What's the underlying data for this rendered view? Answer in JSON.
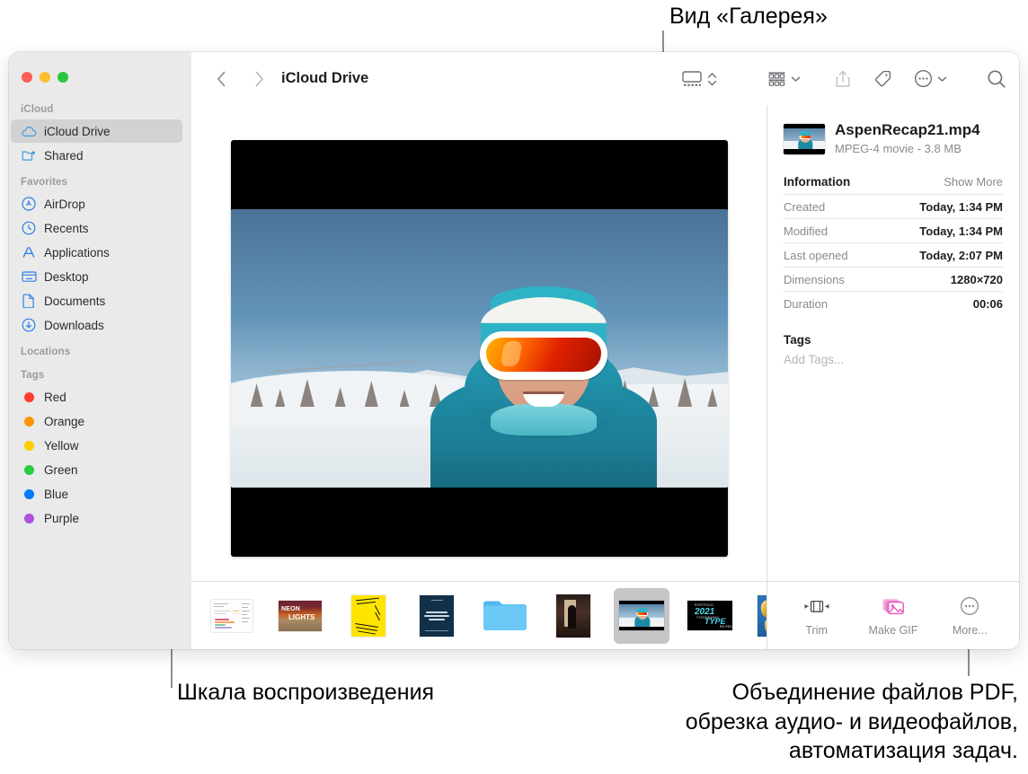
{
  "annotations": {
    "gallery_view": "Вид «Галерея»",
    "playback_scrubber": "Шкала воспроизведения",
    "quick_actions": "Объединение файлов PDF,\nобрезка аудио- и видеофайлов,\nавтоматизация задач."
  },
  "toolbar": {
    "title": "iCloud Drive",
    "back_icon": "chevron-left-icon",
    "forward_icon": "chevron-right-icon",
    "view_icon": "gallery-view-icon",
    "view_chevrons_icon": "chevron-up-down-icon",
    "group_icon": "group-by-icon",
    "group_chevron_icon": "chevron-down-icon",
    "share_icon": "share-icon",
    "tag_icon": "tag-icon",
    "more_icon": "more-actions-icon",
    "more_chevron_icon": "chevron-down-icon",
    "search_icon": "search-icon"
  },
  "window_controls": {
    "close": "close-button",
    "minimize": "minimize-button",
    "zoom": "zoom-button",
    "colors": {
      "close": "#ff5f57",
      "minimize": "#febc2e",
      "zoom": "#28c840"
    }
  },
  "sidebar": {
    "sections": [
      {
        "label": "iCloud",
        "items": [
          {
            "label": "iCloud Drive",
            "icon": "icloud-icon",
            "selected": true
          },
          {
            "label": "Shared",
            "icon": "shared-folder-icon",
            "selected": false
          }
        ]
      },
      {
        "label": "Favorites",
        "items": [
          {
            "label": "AirDrop",
            "icon": "airdrop-icon",
            "selected": false
          },
          {
            "label": "Recents",
            "icon": "clock-icon",
            "selected": false
          },
          {
            "label": "Applications",
            "icon": "applications-icon",
            "selected": false
          },
          {
            "label": "Desktop",
            "icon": "desktop-icon",
            "selected": false
          },
          {
            "label": "Documents",
            "icon": "document-icon",
            "selected": false
          },
          {
            "label": "Downloads",
            "icon": "downloads-icon",
            "selected": false
          }
        ]
      },
      {
        "label": "Locations",
        "items": []
      },
      {
        "label": "Tags",
        "items": [
          {
            "label": "Red",
            "icon": "tag-dot-icon",
            "color": "#ff3b30"
          },
          {
            "label": "Orange",
            "icon": "tag-dot-icon",
            "color": "#ff9500"
          },
          {
            "label": "Yellow",
            "icon": "tag-dot-icon",
            "color": "#ffcc00"
          },
          {
            "label": "Green",
            "icon": "tag-dot-icon",
            "color": "#28cd41"
          },
          {
            "label": "Blue",
            "icon": "tag-dot-icon",
            "color": "#007aff"
          },
          {
            "label": "Purple",
            "icon": "tag-dot-icon",
            "color": "#af52de"
          }
        ]
      }
    ]
  },
  "info_panel": {
    "file_name": "AspenRecap21.mp4",
    "file_subtitle": "MPEG-4 movie - 3.8 MB",
    "section_title": "Information",
    "show_more": "Show More",
    "rows": [
      {
        "key": "Created",
        "value": "Today, 1:34 PM"
      },
      {
        "key": "Modified",
        "value": "Today, 1:34 PM"
      },
      {
        "key": "Last opened",
        "value": "Today, 2:07 PM"
      },
      {
        "key": "Dimensions",
        "value": "1280×720"
      },
      {
        "key": "Duration",
        "value": "00:06"
      }
    ],
    "tags_title": "Tags",
    "add_tags_placeholder": "Add Tags..."
  },
  "quick_actions": [
    {
      "label": "Trim",
      "icon": "trim-icon"
    },
    {
      "label": "Make GIF",
      "icon": "make-gif-icon"
    },
    {
      "label": "More...",
      "icon": "more-circle-icon"
    }
  ],
  "filmstrip": [
    {
      "name": "chart-document-thumbnail",
      "selected": false
    },
    {
      "name": "neon-lights-poster-thumbnail",
      "selected": false,
      "text1": "NEON",
      "text2": "LIGHTS"
    },
    {
      "name": "thank-you-poster-thumbnail",
      "selected": false
    },
    {
      "name": "navy-exhibit-poster-thumbnail",
      "selected": false
    },
    {
      "name": "folder-thumbnail",
      "selected": false
    },
    {
      "name": "doorway-photo-thumbnail",
      "selected": false
    },
    {
      "name": "aspen-video-thumbnail",
      "selected": true
    },
    {
      "name": "typography-2021-poster-thumbnail",
      "selected": false,
      "year": "2021",
      "type": "TYPE"
    },
    {
      "name": "gold-balloons-photo-thumbnail",
      "selected": false
    }
  ]
}
